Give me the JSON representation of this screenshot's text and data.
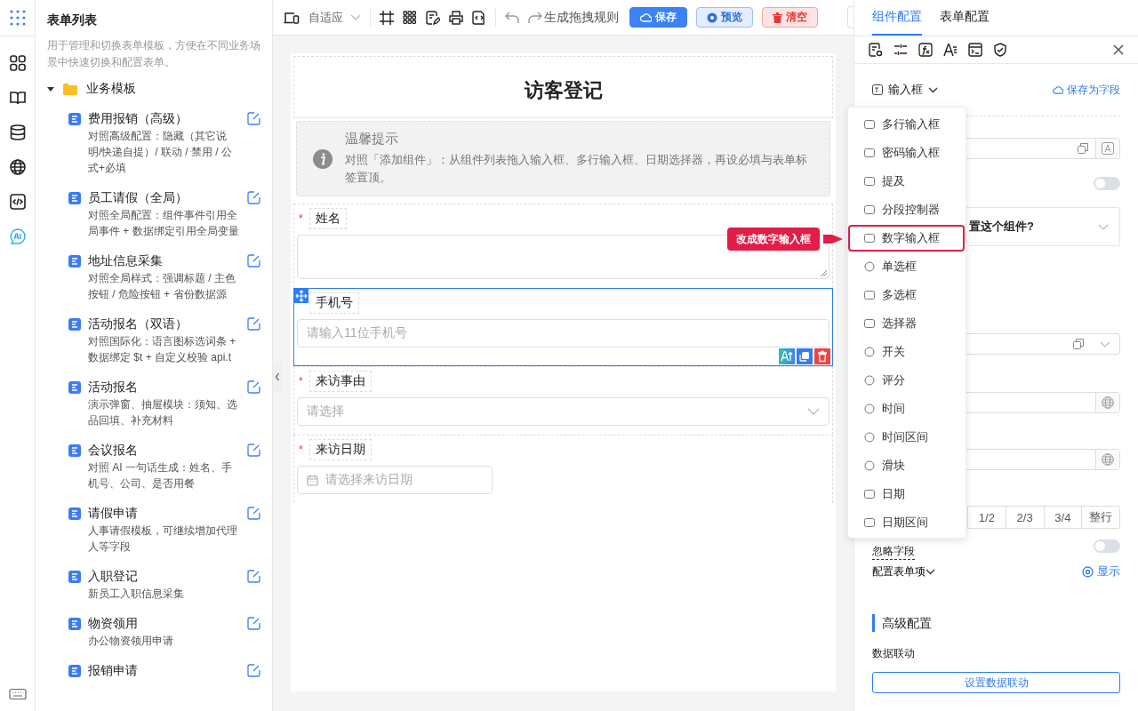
{
  "sidebar": {
    "title": "表单列表",
    "description": "用于管理和切换表单模板，方便在不同业务场景中快速切换和配置表单。",
    "folder": {
      "label": "业务模板",
      "expanded": true,
      "children": [
        {
          "title": "费用报销（高级）",
          "desc": "对照高级配置：隐藏（其它说明/快递自提）/ 联动 / 禁用 / 公式+必填"
        },
        {
          "title": "员工请假（全局）",
          "desc": "对照全局配置：组件事件引用全局事件 + 数据绑定引用全局变量"
        },
        {
          "title": "地址信息采集",
          "desc": "对照全局样式：强调标题 / 主色按钮 / 危险按钮 + 省份数据源"
        },
        {
          "title": "活动报名（双语）",
          "desc": "对照国际化：语言图标选词条 + 数据绑定 $t + 自定义校验 api.t"
        },
        {
          "title": "活动报名",
          "desc": "演示弹窗、抽屉模块：须知、选品回填、补充材料"
        },
        {
          "title": "会议报名",
          "desc": "对照 AI 一句话生成：姓名、手机号、公司、是否用餐"
        },
        {
          "title": "请假申请",
          "desc": "人事请假模板，可继续增加代理人等字段"
        },
        {
          "title": "入职登记",
          "desc": "新员工入职信息采集"
        },
        {
          "title": "物资领用",
          "desc": "办公物资领用申请"
        },
        {
          "title": "报销申请"
        }
      ]
    }
  },
  "toolbar": {
    "device": "自适应",
    "rule_button": "生成拖拽规则",
    "buttons": [
      {
        "kind": "primary",
        "label": "保存"
      },
      {
        "kind": "light",
        "label": "预览"
      },
      {
        "kind": "danger",
        "label": "清空"
      }
    ]
  },
  "form": {
    "title": "访客登记",
    "notice": {
      "title": "温馨提示",
      "text": "对照「添加组件」：从组件列表拖入输入框、多行输入框、日期选择器，再设必填与表单标签置顶。"
    },
    "fields": [
      {
        "mark": "*",
        "label": "姓名",
        "kind": "textarea",
        "selected": false
      },
      {
        "label": "手机号",
        "kind": "input",
        "placeholder": "请输入11位手机号",
        "selected": true
      },
      {
        "mark": "*",
        "label": "来访事由",
        "kind": "select",
        "placeholder": "请选择",
        "selected": false
      },
      {
        "mark": "*",
        "label": "来访日期",
        "kind": "date",
        "placeholder": "请选择来访日期",
        "selected": false
      }
    ]
  },
  "config": {
    "tabs": [
      {
        "label": "组件配置",
        "selected": true
      },
      {
        "label": "表单配置",
        "selected": false
      }
    ],
    "component_type": "输入框",
    "save_field": "保存为字段",
    "collapse_text": "置这个组件?",
    "toggles": [
      {
        "on": false
      },
      {
        "on": false
      }
    ],
    "widths": [
      "1/2",
      "2/3",
      "3/4",
      "整行"
    ],
    "ignore_label": "忽略字段",
    "form_items": "配置表单项",
    "visibility": "显示",
    "advanced_title": "高级配置",
    "linkage_label": "数据联动",
    "linkage_button": "设置数据联动"
  },
  "dropdown": {
    "items": [
      {
        "label": "多行输入框",
        "selected": false
      },
      {
        "label": "密码输入框",
        "selected": false
      },
      {
        "label": "提及",
        "selected": false
      },
      {
        "label": "分段控制器",
        "selected": false
      },
      {
        "label": "数字输入框",
        "selected": true
      },
      {
        "label": "单选框",
        "selected": false
      },
      {
        "label": "多选框",
        "selected": false
      },
      {
        "label": "选择器",
        "selected": false
      },
      {
        "label": "开关",
        "selected": false
      },
      {
        "label": "评分",
        "selected": false
      },
      {
        "label": "时间",
        "selected": false
      },
      {
        "label": "时间区间",
        "selected": false
      },
      {
        "label": "滑块",
        "selected": false
      },
      {
        "label": "日期",
        "selected": false
      },
      {
        "label": "日期区间",
        "selected": false
      }
    ]
  },
  "callout": {
    "text": "改成数字输入框"
  }
}
